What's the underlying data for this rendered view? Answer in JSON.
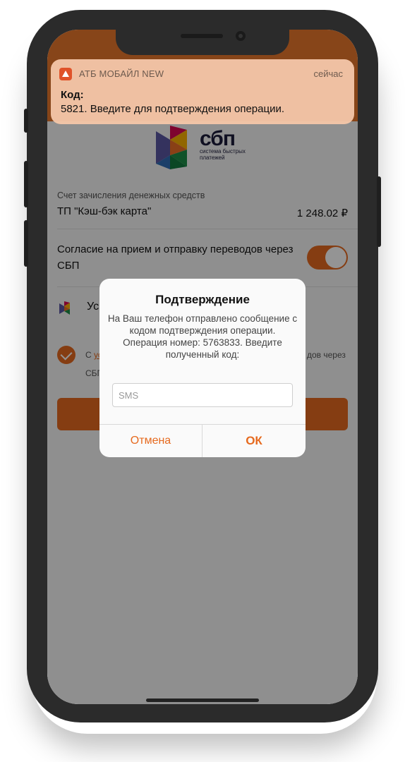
{
  "notification": {
    "app_name": "АТБ МОБАЙЛ NEW",
    "time": "сейчас",
    "title": "Код:",
    "body": "5821. Введите для подтверждения операции.",
    "icon": "atb-app-icon"
  },
  "sbp": {
    "word": "сбп",
    "subtitle": "система быстрых платежей",
    "icon": "sbp-logo-icon"
  },
  "account": {
    "caption": "Счет зачисления денежных средств",
    "name": "ТП \"Кэш-бэк карта\"",
    "amount": "1 248.02 ₽"
  },
  "consent": {
    "text": "Согласие на прием и отправку переводов через СБП",
    "enabled": true
  },
  "row3": {
    "partial_text": "Ус",
    "icon": "sbp-small-icon"
  },
  "agreement": {
    "start": "С",
    "link": "ус",
    "end": "дов через",
    "line2": "СБП",
    "checked": true
  },
  "dialog": {
    "title": "Подтверждение",
    "message": "На Ваш телефон отправлено сообщение с кодом подтверждения операции. Операция номер: 5763833. Введите полученный код:",
    "input_placeholder": "SMS",
    "input_value": "",
    "cancel_label": "Отмена",
    "ok_label": "ОК"
  },
  "colors": {
    "accent": "#e66a1f",
    "header": "#e9772b",
    "notification_bg": "#f4c6a8"
  }
}
